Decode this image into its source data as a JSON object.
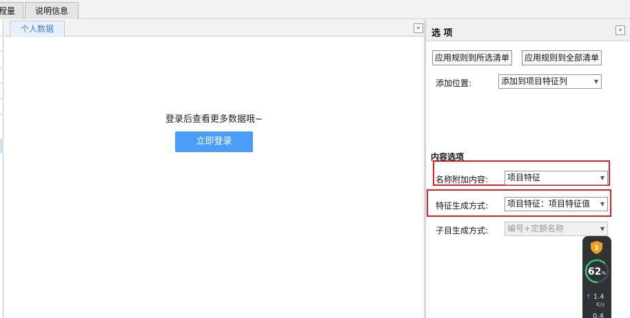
{
  "top_tabs": [
    {
      "label": "程量"
    },
    {
      "label": "说明信息"
    }
  ],
  "center": {
    "tab_label": "个人数据",
    "collapse_glyph": "»",
    "login_message": "登录后查看更多数据哦~",
    "login_button": "立即登录"
  },
  "options": {
    "title": "选 项",
    "collapse_glyph": "»",
    "apply_selected": "应用规则到所选清单",
    "apply_all": "应用规则到全部清单",
    "add_position_label": "添加位置:",
    "add_position_value": "添加到项目特征列",
    "content_section": "内容选项",
    "name_append_label": "名称附加内容:",
    "name_append_value": "项目特征",
    "feature_gen_label": "特征生成方式:",
    "feature_gen_value": "项目特征：项目特征值",
    "sub_gen_label": "子目生成方式:",
    "sub_gen_value": "编号+定额名称",
    "dropdown_glyph": "▼"
  },
  "widget": {
    "badge": "1",
    "percent": "62",
    "percent_unit": "%",
    "percent_value": 62,
    "upload_speed": "1.4",
    "speed_unit": "K/s",
    "download_speed": "0.4",
    "accent_color": "#f0a020",
    "gauge_color": "#3cc36a"
  }
}
